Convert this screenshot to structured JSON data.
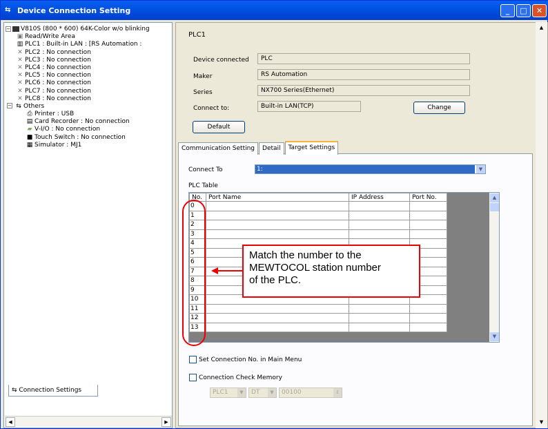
{
  "window": {
    "title": "Device Connection Setting"
  },
  "tree": {
    "root": "V810S (800 * 600) 64K-Color w/o blinking",
    "items": [
      "Read/Write Area",
      "PLC1 : Built-in LAN : [RS Automation :",
      "PLC2 : No connection",
      "PLC3 : No connection",
      "PLC4 : No connection",
      "PLC5 : No connection",
      "PLC6 : No connection",
      "PLC7 : No connection",
      "PLC8 : No connection"
    ],
    "others": "Others",
    "others_items": [
      "Printer : USB",
      "Card Recorder : No connection",
      "V-I/O : No connection",
      "Touch Switch : No connection",
      "Simulator : MJ1"
    ],
    "bottom_tab": "Connection Settings"
  },
  "detail": {
    "heading": "PLC1",
    "device_label": "Device connected",
    "device_value": "PLC",
    "maker_label": "Maker",
    "maker_value": "RS Automation",
    "series_label": "Series",
    "series_value": "NX700 Series(Ethernet)",
    "connect_label": "Connect to:",
    "connect_value": "Built-in LAN(TCP)",
    "change_button": "Change",
    "default_button": "Default"
  },
  "tabs": [
    "Communication Setting",
    "Detail",
    "Target Settings"
  ],
  "target": {
    "connect_to_label": "Connect To",
    "connect_to_value": "1:",
    "plc_table_label": "PLC Table",
    "columns": [
      "No.",
      "Port Name",
      "IP Address",
      "Port No."
    ],
    "rows": [
      "0",
      "1",
      "2",
      "3",
      "4",
      "5",
      "6",
      "7",
      "8",
      "9",
      "10",
      "11",
      "12",
      "13"
    ],
    "set_conn_label": "Set Connection No. in Main Menu",
    "check_mem_label": "Connection Check Memory",
    "check_plc": "PLC1",
    "check_dev": "DT",
    "check_addr": "00100"
  },
  "callout": {
    "line1": "Match the number to the",
    "line2": "MEWTOCOL station number",
    "line3": "of the PLC."
  }
}
